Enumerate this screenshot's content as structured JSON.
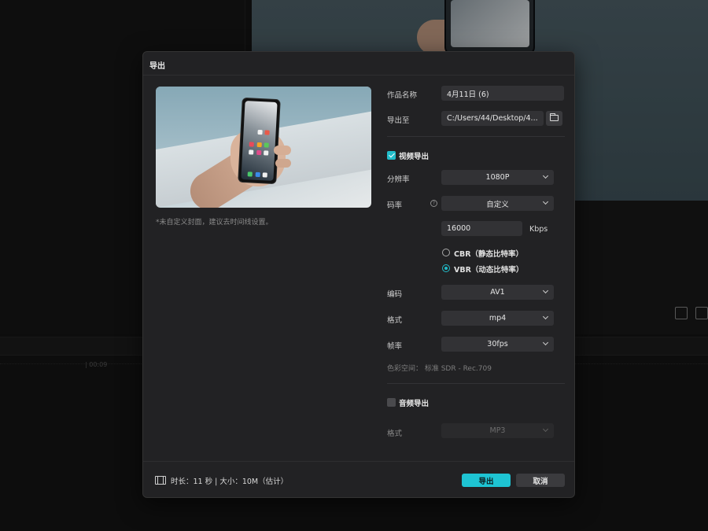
{
  "background": {
    "ruler_timestamp": "| 00:09"
  },
  "dialog": {
    "title": "导出",
    "cover_note": "*未自定义封面，建议去时间线设置。",
    "fields": {
      "name_label": "作品名称",
      "name_value": "4月11日 (6)",
      "export_to_label": "导出至",
      "export_to_value": "C:/Users/44/Desktop/4..."
    },
    "video": {
      "section_label": "视频导出",
      "enabled": true,
      "resolution_label": "分辨率",
      "resolution_value": "1080P",
      "bitrate_label": "码率",
      "bitrate_mode": "自定义",
      "bitrate_value": "16000",
      "bitrate_unit": "Kbps",
      "cbr_label": "CBR（静态比特率）",
      "vbr_label": "VBR（动态比特率）",
      "selected_rate_control": "VBR",
      "codec_label": "编码",
      "codec_value": "AV1",
      "format_label": "格式",
      "format_value": "mp4",
      "framerate_label": "帧率",
      "framerate_value": "30fps",
      "color_space": "色彩空间：  标准 SDR - Rec.709"
    },
    "audio": {
      "section_label": "音频导出",
      "enabled": false,
      "format_label": "格式",
      "format_value": "MP3"
    },
    "footer": {
      "info": "时长：11 秒 | 大小：10M（估计）",
      "export_button": "导出",
      "cancel_button": "取消"
    },
    "colors": {
      "accent": "#1ec4d3",
      "dialog_bg": "#222224",
      "field_bg": "#323235"
    }
  }
}
